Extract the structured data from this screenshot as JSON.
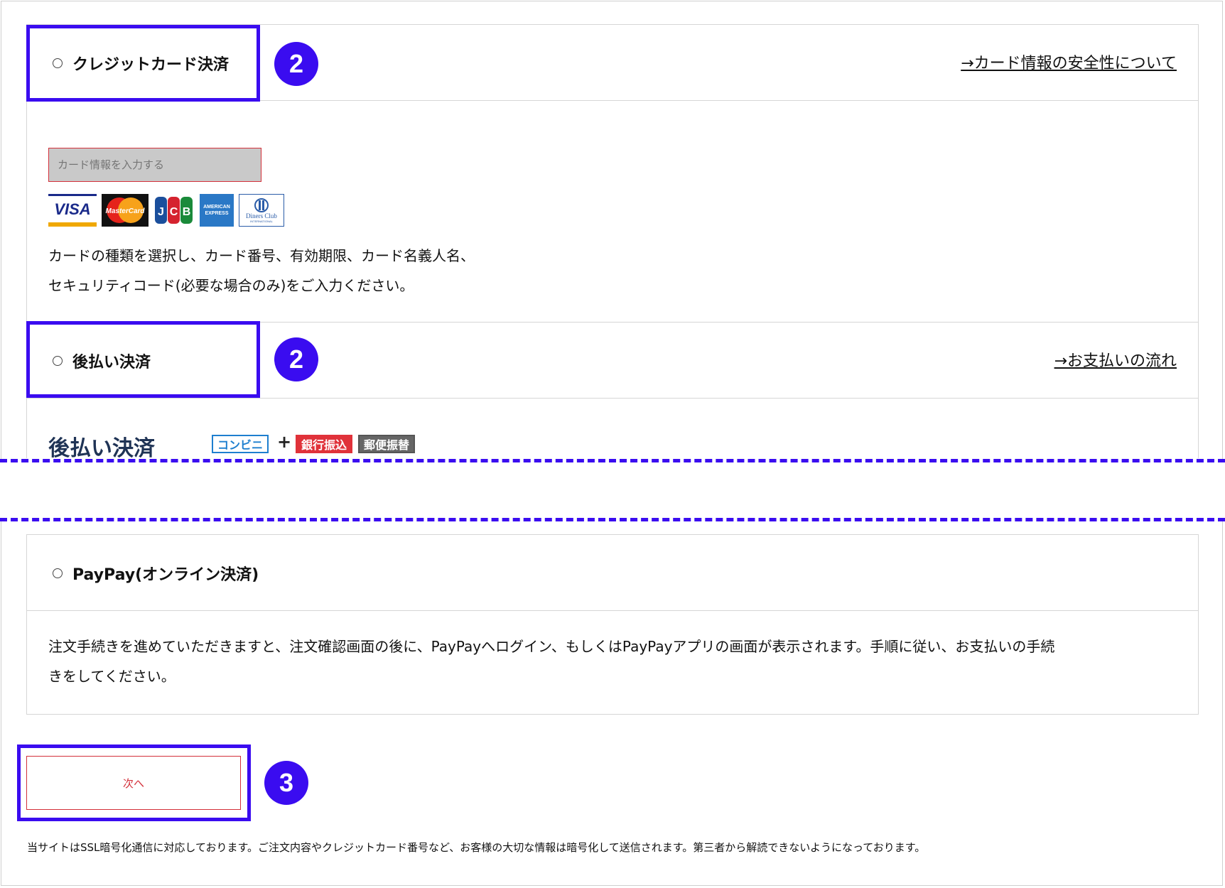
{
  "credit": {
    "label": "クレジットカード決済",
    "badge": "2",
    "link": "→カード情報の安全性について",
    "input_placeholder": "カード情報を入力する",
    "brands": [
      "VISA",
      "MasterCard",
      "JCB",
      "AMERICAN EXPRESS",
      "Diners Club INTERNATIONAL"
    ],
    "desc_line1": "カードの種類を選択し、カード番号、有効期限、カード名義人名、",
    "desc_line2": "セキュリティコード(必要な場合のみ)をご入力ください。"
  },
  "deferred": {
    "label": "後払い決済",
    "badge": "2",
    "link": "→お支払いの流れ",
    "title": "後払い決済",
    "tag_conveni": "コンビニ",
    "plus": "+",
    "tag_bank": "銀行振込",
    "tag_post": "郵便振替"
  },
  "paypay": {
    "label": "PayPay(オンライン決済)",
    "desc_line1": "注文手続きを進めていただきますと、注文確認画面の後に、PayPayへログイン、もしくはPayPayアプリの画面が表示されます。手順に従い、お支払いの手続",
    "desc_line2": "きをしてください。"
  },
  "next": {
    "label": "次へ",
    "badge": "3"
  },
  "footer": {
    "ssl_note": "当サイトはSSL暗号化通信に対応しております。ご注文内容やクレジットカード番号など、お客様の大切な情報は暗号化して送信されます。第三者から解読できないようになっております。"
  },
  "colors": {
    "highlight": "#3a0cf0",
    "accent_red": "#d3303a",
    "title_navy": "#1f3355"
  }
}
